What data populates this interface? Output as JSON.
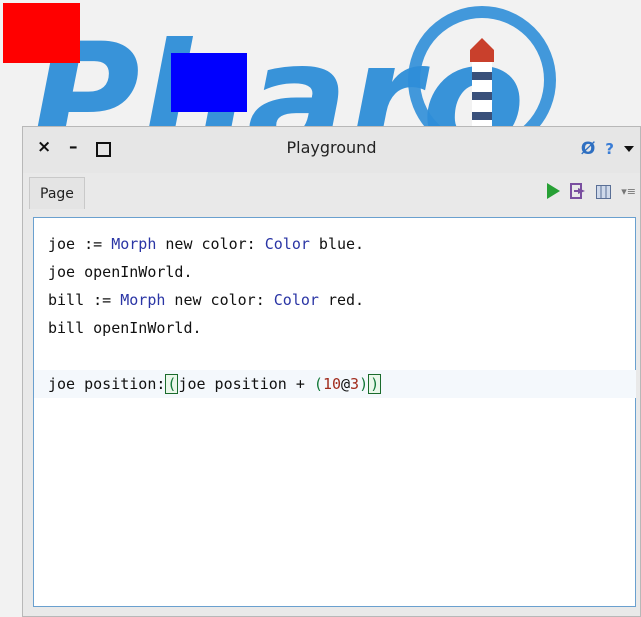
{
  "world": {
    "logo_text": "Pharo",
    "colors": {
      "logo_blue": "#2f8ed8",
      "morph_red": "#ff0000",
      "morph_blue": "#0000ff"
    }
  },
  "window": {
    "title": "Playground",
    "controls": {
      "close": "×",
      "minimize": "–",
      "maximize": "maximize-box"
    },
    "toolbar_right": {
      "refresh_icon": "Ø",
      "help_icon": "?",
      "menu_icon": "dropdown-triangle"
    }
  },
  "tabs": [
    {
      "label": "Page"
    }
  ],
  "tab_tools": {
    "run_icon": "play-triangle",
    "inspect_icon": "inspect-arrow-icon",
    "browse_icon": "columns-icon",
    "menu_icon": "▾≡"
  },
  "editor": {
    "lines": [
      {
        "parts": [
          {
            "t": "joe := "
          },
          {
            "t": "Morph",
            "k": "kw"
          },
          {
            "t": " new color: "
          },
          {
            "t": "Color",
            "k": "kw"
          },
          {
            "t": " blue."
          }
        ]
      },
      {
        "parts": [
          {
            "t": "joe openInWorld."
          }
        ]
      },
      {
        "parts": [
          {
            "t": "bill := "
          },
          {
            "t": "Morph",
            "k": "kw"
          },
          {
            "t": " new color: "
          },
          {
            "t": "Color",
            "k": "kw"
          },
          {
            "t": " red."
          }
        ]
      },
      {
        "parts": [
          {
            "t": "bill openInWorld."
          }
        ]
      },
      {
        "parts": []
      },
      {
        "cursor": true,
        "parts": [
          {
            "t": "joe position:"
          },
          {
            "t": "(",
            "k": "hl-paren"
          },
          {
            "t": "joe position + "
          },
          {
            "t": "(",
            "k": "paren"
          },
          {
            "t": "10",
            "k": "num"
          },
          {
            "t": "@"
          },
          {
            "t": "3",
            "k": "num"
          },
          {
            "t": ")",
            "k": "paren"
          },
          {
            "t": ")",
            "k": "hl-paren"
          }
        ]
      }
    ]
  }
}
